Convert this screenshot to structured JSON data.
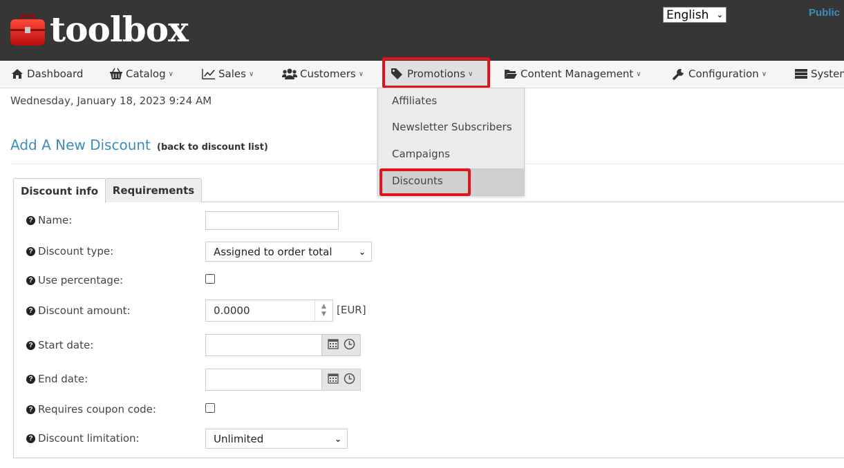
{
  "header": {
    "logo_text": "toolbox",
    "language": "English",
    "public_link": "Public"
  },
  "nav": {
    "items": [
      {
        "label": "Dashboard",
        "icon": "home-icon"
      },
      {
        "label": "Catalog",
        "icon": "basket-icon"
      },
      {
        "label": "Sales",
        "icon": "line-chart-icon"
      },
      {
        "label": "Customers",
        "icon": "users-icon"
      },
      {
        "label": "Promotions",
        "icon": "tags-icon"
      },
      {
        "label": "Content Management",
        "icon": "folder-open-icon"
      },
      {
        "label": "Configuration",
        "icon": "wrench-icon"
      },
      {
        "label": "System",
        "icon": "server-icon"
      }
    ],
    "dropdown": [
      "Affiliates",
      "Newsletter Subscribers",
      "Campaigns",
      "Discounts"
    ]
  },
  "page": {
    "date_text": "Wednesday, January 18, 2023 9:24 AM",
    "title": "Add A New Discount",
    "back_link": "(back to discount list)"
  },
  "tabs": [
    "Discount info",
    "Requirements"
  ],
  "form": {
    "name_label": "Name:",
    "name_value": "",
    "discount_type_label": "Discount type:",
    "discount_type_value": "Assigned to order total",
    "use_percentage_label": "Use percentage:",
    "discount_amount_label": "Discount amount:",
    "discount_amount_value": "0.0000",
    "currency": "[EUR]",
    "start_date_label": "Start date:",
    "end_date_label": "End date:",
    "requires_coupon_label": "Requires coupon code:",
    "discount_limitation_label": "Discount limitation:",
    "discount_limitation_value": "Unlimited"
  }
}
